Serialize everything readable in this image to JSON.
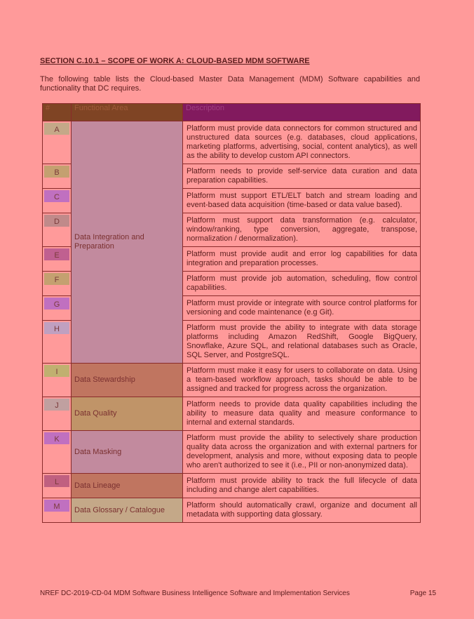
{
  "section_title": "SECTION C.10.1 – SCOPE OF WORK A: CLOUD-BASED MDM SOFTWARE",
  "intro": "The following table lists the Cloud-based Master Data Management (MDM) Software capabilities and functionality that DC requires.",
  "table": {
    "headers": [
      "#",
      "Functional Area",
      "Description"
    ],
    "groups": [
      {
        "category": "Data Integration and Preparation",
        "color": "#c28a9e",
        "rows": [
          {
            "id": "A",
            "color": "#c4a888",
            "desc": "Platform must provide data connectors for common structured and unstructured data sources (e.g. databases, cloud applications, marketing platforms, advertising, social, content analytics), as well as the ability to develop custom API connectors."
          },
          {
            "id": "B",
            "color": "#c4a070",
            "desc": "Platform needs to provide self-service data curation and data preparation capabilities."
          },
          {
            "id": "C",
            "color": "#c070c0",
            "desc": "Platform must support ETL/ELT batch and stream loading and event-based data acquisition (time-based or data value based)."
          },
          {
            "id": "D",
            "color": "#c08a8a",
            "desc": "Platform must support data transformation (e.g. calculator, window/ranking, type conversion, aggregate, transpose, normalization / denormalization)."
          },
          {
            "id": "E",
            "color": "#c06090",
            "desc": "Platform must provide audit and error log capabilities for data integration and preparation processes."
          },
          {
            "id": "F",
            "color": "#c4a070",
            "desc": "Platform must provide job automation, scheduling, flow control capabilities."
          },
          {
            "id": "G",
            "color": "#c070c0",
            "desc": "Platform must provide or integrate with source control platforms for versioning and code maintenance (e.g Git)."
          },
          {
            "id": "H",
            "color": "#c0a0c0",
            "desc": "Platform must provide the ability to integrate with data storage platforms including Amazon RedShift, Google BigQuery, Snowflake, Azure SQL, and relational databases such as Oracle, SQL Server, and PostgreSQL."
          }
        ]
      },
      {
        "category": "Data Stewardship",
        "color": "#c07560",
        "rows": [
          {
            "id": "I",
            "color": "#c0b070",
            "desc": "Platform must make it easy for users to collaborate on data. Using a team-based workflow approach, tasks should be able to be assigned and tracked for progress across the organization."
          }
        ]
      },
      {
        "category": "Data Quality",
        "color": "#c09468",
        "rows": [
          {
            "id": "J",
            "color": "#c0a0a0",
            "desc": "Platform needs to provide data quality capabilities including the ability to measure data quality and measure conformance to internal and external standards."
          }
        ]
      },
      {
        "category": "Data Masking",
        "color": "#c28a9e",
        "rows": [
          {
            "id": "K",
            "color": "#c070c0",
            "desc": "Platform must provide the ability to selectively share production quality data across the organization and with external partners for development, analysis and more, without exposing data to people who aren't authorized to see it (i.e., PII or non-anonymized data)."
          }
        ]
      },
      {
        "category": "Data Lineage",
        "color": "#c07560",
        "rows": [
          {
            "id": "L",
            "color": "#c06080",
            "desc": "Platform must provide ability to track the full lifecycle of data including and change alert capabilities."
          }
        ]
      },
      {
        "category": "Data Glossary / Catalogue",
        "color": "#c4a888",
        "rows": [
          {
            "id": "M",
            "color": "#c070c0",
            "desc": "Platform should automatically crawl, organize and document all metadata with supporting data glossary."
          }
        ]
      }
    ]
  },
  "footer": {
    "left": "NREF DC-2019-CD-04 MDM Software Business Intelligence Software and Implementation Services",
    "right": "Page 15"
  }
}
